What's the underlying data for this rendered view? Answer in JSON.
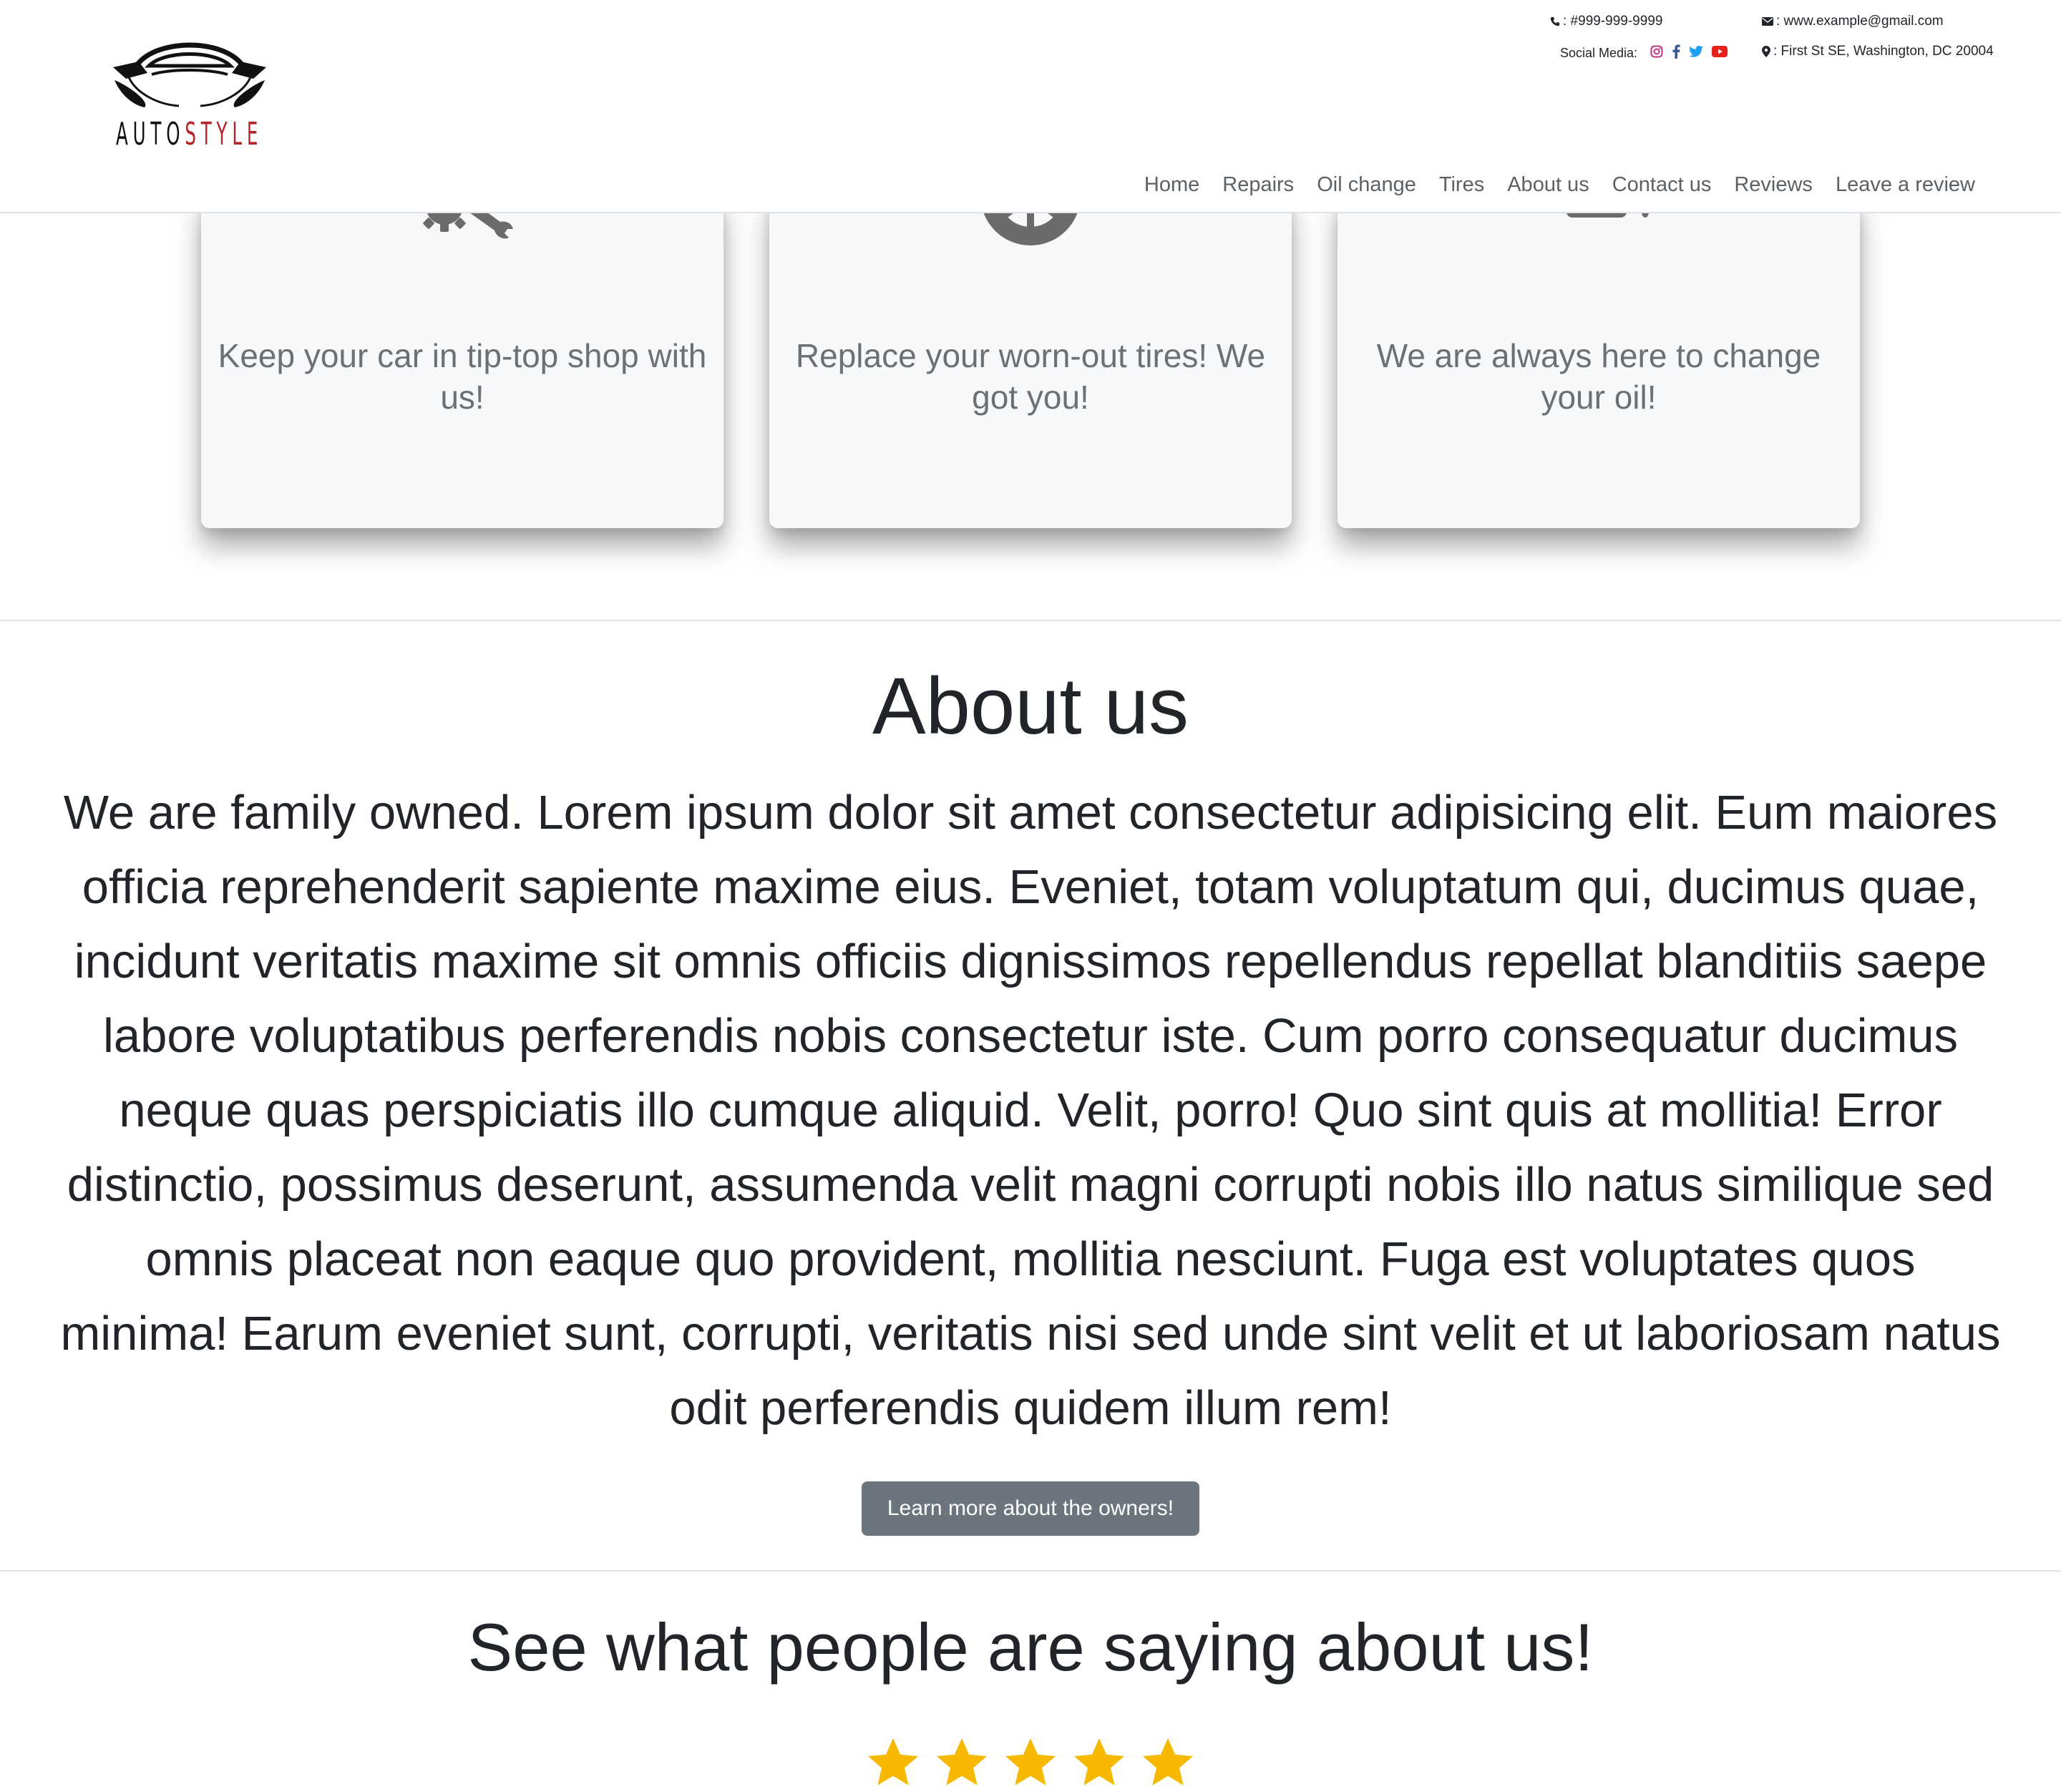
{
  "brand": {
    "name_part1": "AUTO",
    "name_part2": "STYLE",
    "accent_color": "#b4262a"
  },
  "contact": {
    "phone": ": #999-999-9999",
    "email": ": www.example@gmail.com",
    "social_label": "Social Media:",
    "address": ": First St SE, Washington, DC 20004",
    "icons": [
      "phone-icon",
      "envelope-icon",
      "map-marker-icon",
      "instagram-icon",
      "facebook-icon",
      "twitter-icon",
      "youtube-icon"
    ]
  },
  "nav": {
    "items": [
      {
        "label": "Home"
      },
      {
        "label": "Repairs"
      },
      {
        "label": "Oil change"
      },
      {
        "label": "Tires"
      },
      {
        "label": "About us"
      },
      {
        "label": "Contact us"
      },
      {
        "label": "Reviews"
      },
      {
        "label": "Leave a review"
      }
    ]
  },
  "services": [
    {
      "icon": "tools-icon",
      "text": "Keep your car in tip-top shop with us!"
    },
    {
      "icon": "tire-icon",
      "text": "Replace your worn-out tires! We got you!"
    },
    {
      "icon": "oil-can-icon",
      "text": "We are always here to change your oil!"
    }
  ],
  "about": {
    "title": "About us",
    "text": "We are family owned. Lorem ipsum dolor sit amet consectetur adipisicing elit. Eum maiores officia reprehenderit sapiente maxime eius. Eveniet, totam voluptatum qui, ducimus quae, incidunt veritatis maxime sit omnis officiis dignissimos repellendus repellat blanditiis saepe labore voluptatibus perferendis nobis consectetur iste. Cum porro consequatur ducimus neque quas perspiciatis illo cumque aliquid. Velit, porro! Quo sint quis at mollitia! Error distinctio, possimus deserunt, assumenda velit magni corrupti nobis illo natus similique sed omnis placeat non eaque quo provident, mollitia nesciunt. Fuga est voluptates quos minima! Earum eveniet sunt, corrupti, veritatis nisi sed unde sint velit et ut laboriosam natus odit perferendis quidem illum rem!",
    "button_label": "Learn more about the owners!"
  },
  "reviews": {
    "title": "See what people are saying about us!",
    "rating": 5,
    "star_color": "#f6b900"
  }
}
